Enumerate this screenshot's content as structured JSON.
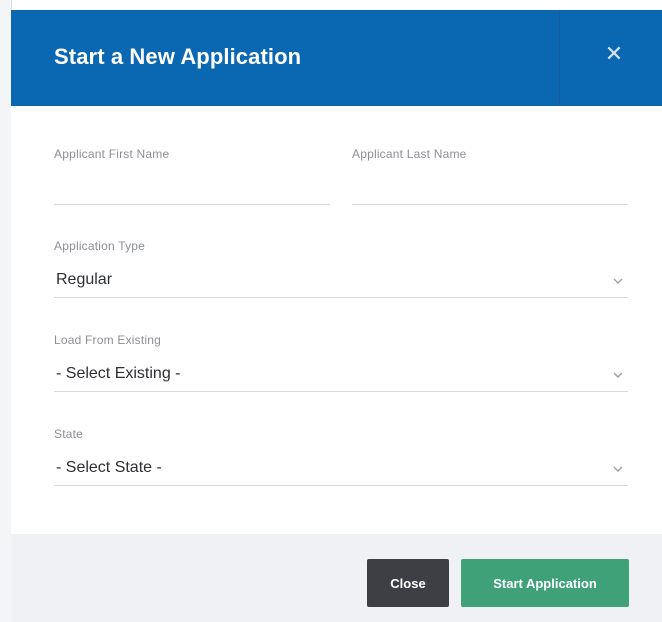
{
  "modal": {
    "title": "Start a New Application",
    "close_icon": "close-icon"
  },
  "form": {
    "first_name": {
      "label": "Applicant First Name",
      "value": ""
    },
    "last_name": {
      "label": "Applicant Last Name",
      "value": ""
    },
    "application_type": {
      "label": "Application Type",
      "selected": "Regular"
    },
    "load_from_existing": {
      "label": "Load From Existing",
      "selected": "- Select Existing -"
    },
    "state": {
      "label": "State",
      "selected": "- Select State -"
    }
  },
  "footer": {
    "close_label": "Close",
    "start_label": "Start Application"
  },
  "colors": {
    "header": "#0a67b2",
    "close_button": "#3d3f44",
    "start_button": "#3fa178",
    "footer": "#f0f1f4"
  }
}
